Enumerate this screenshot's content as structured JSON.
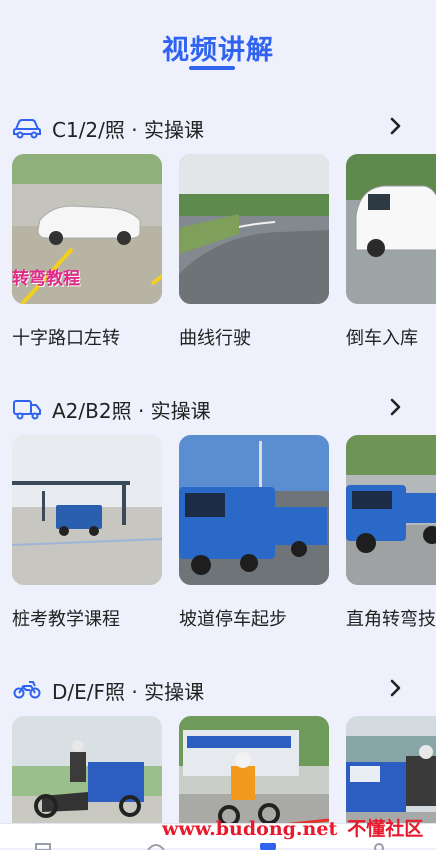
{
  "page": {
    "title": "视频讲解"
  },
  "sections": [
    {
      "title": "C1/2/照 · 实操课",
      "icon": "car-icon",
      "cards": [
        {
          "label": "十字路口左转",
          "badge": "转弯教程"
        },
        {
          "label": "曲线行驶"
        },
        {
          "label": "倒车入库"
        }
      ]
    },
    {
      "title": "A2/B2照 · 实操课",
      "icon": "truck-icon",
      "cards": [
        {
          "label": "桩考教学课程"
        },
        {
          "label": "坡道停车起步"
        },
        {
          "label": "直角转弯技"
        }
      ]
    },
    {
      "title": "D/E/F照 · 实操课",
      "icon": "motorcycle-icon",
      "cards": [
        {
          "label": ""
        },
        {
          "label": ""
        },
        {
          "label": ""
        }
      ]
    }
  ],
  "watermark": {
    "url": "www.budong.net",
    "text": "不懂社区"
  },
  "colors": {
    "accent": "#2f63f0",
    "background": "#eef0fb",
    "watermark": "#e8192c"
  }
}
